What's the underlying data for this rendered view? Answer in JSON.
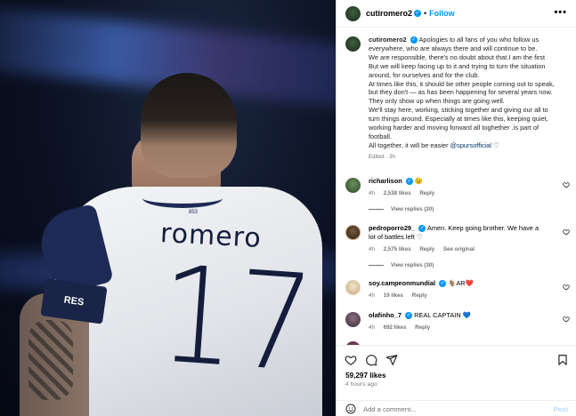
{
  "header": {
    "username": "cutiromero2",
    "follow_label": "Follow",
    "separator": "•",
    "more_label": "•••"
  },
  "photo": {
    "shirt_name": "romero",
    "shirt_number": "17",
    "armband_text": "RES",
    "collar_tag": "853"
  },
  "caption": {
    "username": "cutiromero2",
    "lines": [
      "Apologies to all fans of you who follow us",
      "everywhere, who are always there and will continue to be.",
      "We are responsible, there's no doubt about that.I am the first",
      "But we will keep facing up to it and trying to turn the situation",
      "around, for ourselves and for the club.",
      "At times like this, it should be other people coming out to speak,",
      "but they don't — as has been happening for several years now.",
      "They only show up when things are going well.",
      "We'll stay here, working, sticking together and giving our all to",
      "turn things around. Especially at times like this, keeping quiet,",
      "working harder and moving forward all toghether .is part of",
      "football."
    ],
    "last_line_text": "All together, it will be easier",
    "mention": "@spursofficial",
    "meta": "Edited · 3h"
  },
  "comments": [
    {
      "username": "richarlison",
      "text": "",
      "emoji": "😉",
      "time": "4h",
      "likes": "2,538 likes",
      "reply": "Reply",
      "see_original": "",
      "view_replies": "View replies (20)",
      "avatar_color": "#2f5a2f"
    },
    {
      "username": "pedroporro29_",
      "text": "Amen. Keep going brother. We have a lot of battles left",
      "emoji": "♡",
      "time": "4h",
      "likes": "2,575 likes",
      "reply": "Reply",
      "see_original": "See original",
      "view_replies": "View replies (30)",
      "avatar_color": "#3b2a1e"
    },
    {
      "username": "soy.campeonmundial",
      "text": "",
      "emoji": "🐐AR❤️",
      "time": "4h",
      "likes": "19 likes",
      "reply": "Reply",
      "see_original": "",
      "view_replies": "",
      "avatar_color": "#d9c2a2"
    },
    {
      "username": "olafinho_7",
      "text": "REAL CAPTAIN",
      "emoji": "💙",
      "time": "4h",
      "likes": "692 likes",
      "reply": "Reply",
      "see_original": "",
      "view_replies": "",
      "avatar_color": "#5d4a55"
    }
  ],
  "footer": {
    "likes": "59,297 likes",
    "time_ago": "4 hours ago",
    "add_comment_placeholder": "Add a comment...",
    "post_label": "Post"
  },
  "colors": {
    "accent": "#0095f6",
    "meta_gray": "#737373",
    "post_disabled": "#b3dbff"
  }
}
